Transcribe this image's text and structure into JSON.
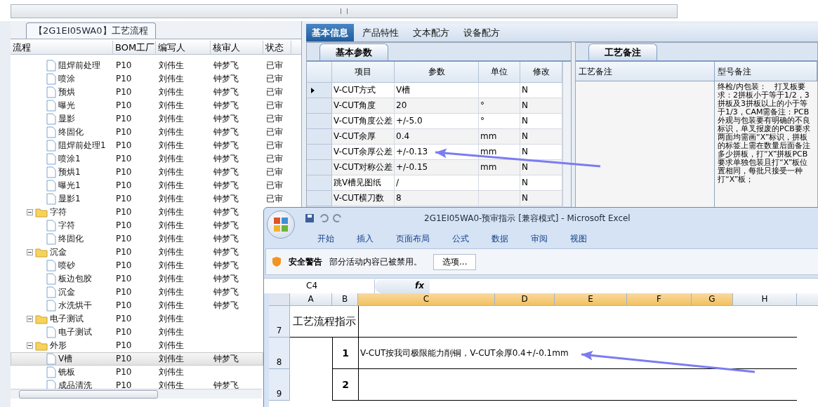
{
  "process_panel": {
    "tab": "【2G1EI05WA0】工艺流程",
    "columns": [
      "流程",
      "BOM工厂",
      "编写人",
      "核审人",
      "状态"
    ],
    "tree": [
      {
        "kind": "folder",
        "children": [
          {
            "name": "阻焊前处理",
            "bom": "P10",
            "writer": "刘伟生",
            "reviewer": "钟梦飞",
            "status": "已审",
            "selected": false
          },
          {
            "name": "喷涂",
            "bom": "P10",
            "writer": "刘伟生",
            "reviewer": "钟梦飞",
            "status": "已审",
            "selected": false
          },
          {
            "name": "预烘",
            "bom": "P10",
            "writer": "刘伟生",
            "reviewer": "钟梦飞",
            "status": "已审",
            "selected": false
          },
          {
            "name": "曝光",
            "bom": "P10",
            "writer": "刘伟生",
            "reviewer": "钟梦飞",
            "status": "已审",
            "selected": false
          },
          {
            "name": "显影",
            "bom": "P10",
            "writer": "刘伟生",
            "reviewer": "钟梦飞",
            "status": "已审",
            "selected": false
          },
          {
            "name": "终固化",
            "bom": "P10",
            "writer": "刘伟生",
            "reviewer": "钟梦飞",
            "status": "已审",
            "selected": false
          },
          {
            "name": "阻焊前处理1",
            "bom": "P10",
            "writer": "刘伟生",
            "reviewer": "钟梦飞",
            "status": "已审",
            "selected": false
          },
          {
            "name": "喷涂1",
            "bom": "P10",
            "writer": "刘伟生",
            "reviewer": "钟梦飞",
            "status": "已审",
            "selected": false
          },
          {
            "name": "预烘1",
            "bom": "P10",
            "writer": "刘伟生",
            "reviewer": "钟梦飞",
            "status": "已审",
            "selected": false
          },
          {
            "name": "曝光1",
            "bom": "P10",
            "writer": "刘伟生",
            "reviewer": "钟梦飞",
            "status": "已审",
            "selected": false
          },
          {
            "name": "显影1",
            "bom": "P10",
            "writer": "刘伟生",
            "reviewer": "钟梦飞",
            "status": "已审",
            "selected": false
          }
        ]
      },
      {
        "kind": "folder",
        "name": "字符",
        "bom": "P10",
        "writer": "刘伟生",
        "reviewer": "钟梦飞",
        "expanded": true,
        "selected": false,
        "children": [
          {
            "name": "字符",
            "bom": "P10",
            "writer": "刘伟生",
            "reviewer": "钟梦飞",
            "selected": false
          },
          {
            "name": "终固化",
            "bom": "P10",
            "writer": "刘伟生",
            "reviewer": "钟梦飞",
            "selected": false
          }
        ]
      },
      {
        "kind": "folder",
        "name": "沉金",
        "bom": "P10",
        "writer": "刘伟生",
        "reviewer": "钟梦飞",
        "expanded": true,
        "selected": false,
        "children": [
          {
            "name": "喷砂",
            "bom": "P10",
            "writer": "刘伟生",
            "reviewer": "钟梦飞",
            "selected": false
          },
          {
            "name": "板边包胶",
            "bom": "P10",
            "writer": "刘伟生",
            "reviewer": "钟梦飞",
            "selected": false
          },
          {
            "name": "沉金",
            "bom": "P10",
            "writer": "刘伟生",
            "reviewer": "钟梦飞",
            "selected": false
          },
          {
            "name": "水洗烘干",
            "bom": "P10",
            "writer": "刘伟生",
            "reviewer": "钟梦飞",
            "selected": false
          }
        ]
      },
      {
        "kind": "folder",
        "name": "电子测试",
        "bom": "P10",
        "writer": "刘伟生",
        "expanded": true,
        "selected": false,
        "children": [
          {
            "name": "电子测试",
            "bom": "P10",
            "writer": "刘伟生",
            "selected": false
          }
        ]
      },
      {
        "kind": "folder",
        "name": "外形",
        "bom": "P10",
        "writer": "刘伟生",
        "expanded": true,
        "selected": false,
        "children": [
          {
            "name": "V槽",
            "bom": "P10",
            "writer": "刘伟生",
            "reviewer": "钟梦飞",
            "selected": true
          },
          {
            "name": "铣板",
            "bom": "P10",
            "writer": "刘伟生",
            "selected": false
          },
          {
            "name": "成品清洗",
            "bom": "P10",
            "writer": "刘伟生",
            "reviewer": "钟梦飞",
            "selected": false
          }
        ]
      }
    ]
  },
  "detail_panel": {
    "tabs": [
      {
        "label": "基本信息",
        "selected": true
      },
      {
        "label": "产品特性",
        "selected": false
      },
      {
        "label": "文本配方",
        "selected": false
      },
      {
        "label": "设备配方",
        "selected": false
      }
    ],
    "params": {
      "tab": "基本参数",
      "columns": [
        "项目",
        "参数",
        "单位",
        "修改"
      ],
      "rows": [
        {
          "item": "V-CUT方式",
          "value": "V槽",
          "modified": "N",
          "selected": true
        },
        {
          "item": "V-CUT角度",
          "value": "20",
          "unit": "°",
          "modified": "N",
          "selected": false
        },
        {
          "item": "V-CUT角度公差",
          "value": "+/-5.0",
          "unit": "°",
          "modified": "N",
          "selected": false
        },
        {
          "item": "V-CUT余厚",
          "value": "0.4",
          "unit": "mm",
          "modified": "N",
          "selected": false
        },
        {
          "item": "V-CUT余厚公差",
          "value": "+/-0.13",
          "unit": "mm",
          "modified": "N",
          "selected": false
        },
        {
          "item": "V-CUT对称公差",
          "value": "+/-0.15",
          "unit": "mm",
          "modified": "N",
          "selected": false
        },
        {
          "item": "跳V槽见图纸",
          "value": "/",
          "modified": "N",
          "selected": false
        },
        {
          "item": "V-CUT横刀数",
          "value": "8",
          "modified": "N",
          "selected": false
        }
      ]
    },
    "remarks": {
      "tab": "工艺备注",
      "columns": [
        "工艺备注",
        "型号备注"
      ],
      "model_note": "终检/内包装：　打叉板要求：2拼板小于等于1/2，3拼板及3拼板以上的小于等于1/3，CAM需备注：PCB外观与包装要有明确的不良标识，单叉报废的PCB要求两面均需画“X”标识，拼板的标签上需在数量后面备注多少拼板，打“X”拼板PCB要求单独包装且打“X”板位置相同，每批只接受一种打“X”板；"
    }
  },
  "excel": {
    "title": "2G1EI05WA0-预审指示  [兼容模式] - Microsoft Excel",
    "ribbon_tabs": [
      "开始",
      "插入",
      "页面布局",
      "公式",
      "数据",
      "审阅",
      "视图"
    ],
    "security_bar": {
      "label": "安全警告",
      "message": "部分活动内容已被禁用。",
      "button": "选项..."
    },
    "name_box": "C4",
    "fx": "fx",
    "columns": [
      {
        "label": "A",
        "selected": false
      },
      {
        "label": "B",
        "selected": false
      },
      {
        "label": "C",
        "selected": true
      },
      {
        "label": "D",
        "selected": true
      },
      {
        "label": "E",
        "selected": true
      },
      {
        "label": "F",
        "selected": true
      },
      {
        "label": "G",
        "selected": true
      },
      {
        "label": "H",
        "selected": false
      }
    ],
    "rows": [
      {
        "number": "7",
        "a": "工艺流程指示"
      },
      {
        "number": "8",
        "b": "1",
        "c": "V-CUT按我司极限能力削铜，V-CUT余厚0.4+/-0.1mm"
      },
      {
        "number": "9",
        "b": "2"
      }
    ]
  }
}
